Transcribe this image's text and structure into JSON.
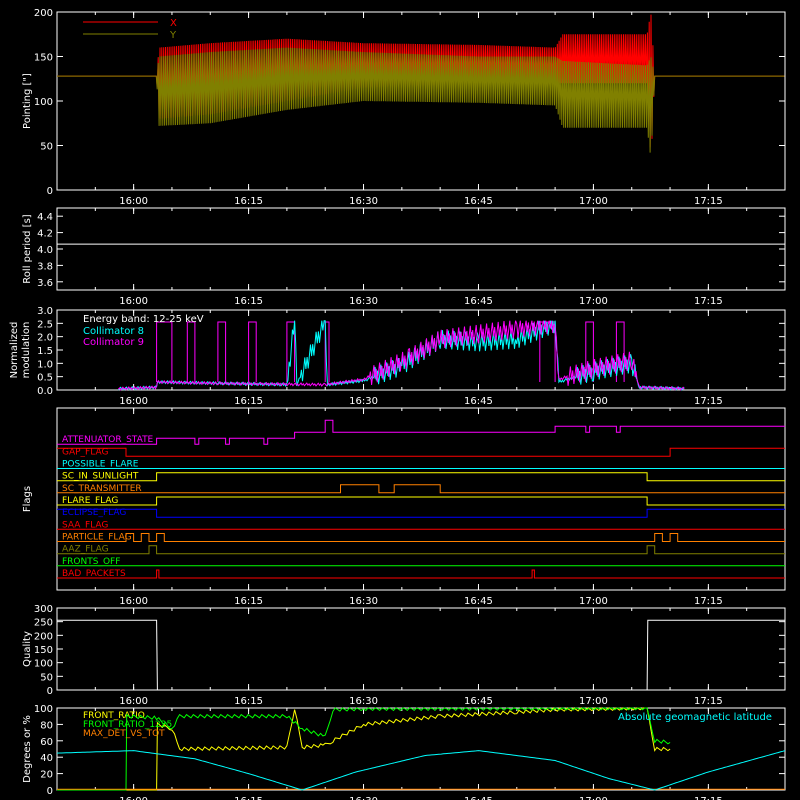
{
  "chart_data": [
    {
      "type": "line",
      "ylabel": "Pointing [\"]",
      "ylim": [
        0,
        200
      ],
      "yticks": [
        0,
        50,
        100,
        150,
        200
      ],
      "xlim": [
        "15:50",
        "17:25"
      ],
      "xticks": [
        "16:00",
        "16:15",
        "16:30",
        "16:45",
        "17:00",
        "17:15"
      ],
      "legend": {
        "position": "top-left",
        "entries": [
          "X",
          "Y"
        ]
      },
      "series": [
        {
          "name": "X",
          "color": "#ff0000",
          "envelope": [
            [
              "15:50",
              128,
              128
            ],
            [
              "16:03",
              128,
              128
            ],
            [
              "16:03.3",
              80,
              160
            ],
            [
              "16:10",
              85,
              165
            ],
            [
              "16:20",
              100,
              170
            ],
            [
              "16:30",
              115,
              165
            ],
            [
              "16:45",
              120,
              163
            ],
            [
              "16:55",
              120,
              160
            ],
            [
              "16:56",
              120,
              175
            ],
            [
              "17:07",
              120,
              175
            ],
            [
              "17:07.5",
              30,
              200
            ],
            [
              "17:08",
              128,
              128
            ],
            [
              "17:25",
              128,
              128
            ]
          ]
        },
        {
          "name": "Y",
          "color": "#808000",
          "envelope": [
            [
              "15:50",
              128,
              128
            ],
            [
              "16:03",
              128,
              128
            ],
            [
              "16:03.3",
              72,
              150
            ],
            [
              "16:10",
              75,
              155
            ],
            [
              "16:20",
              90,
              160
            ],
            [
              "16:30",
              100,
              155
            ],
            [
              "16:45",
              98,
              150
            ],
            [
              "16:55",
              95,
              150
            ],
            [
              "16:56",
              70,
              145
            ],
            [
              "17:07",
              70,
              140
            ],
            [
              "17:07.5",
              35,
              150
            ],
            [
              "17:08",
              128,
              128
            ],
            [
              "17:25",
              128,
              128
            ]
          ]
        }
      ]
    },
    {
      "type": "line",
      "ylabel": "Roll period [s]",
      "ylim": [
        3.5,
        4.5
      ],
      "yticks": [
        "3.6",
        "3.8",
        "4.0",
        "4.2",
        "4.4"
      ],
      "xticks": [
        "16:00",
        "16:15",
        "16:30",
        "16:45",
        "17:00",
        "17:15"
      ],
      "series": [
        {
          "color": "#ffffff",
          "points": [
            [
              "15:50",
              4.06
            ],
            [
              "17:25",
              4.06
            ]
          ]
        }
      ]
    },
    {
      "type": "line",
      "ylabel": "Normalized modulation",
      "ylim": [
        0,
        3
      ],
      "yticks": [
        "0.0",
        "0.5",
        "1.0",
        "1.5",
        "2.0",
        "2.5",
        "3.0"
      ],
      "xticks": [
        "16:00",
        "16:15",
        "16:30",
        "16:45",
        "17:00",
        "17:15"
      ],
      "legend_title": "Energy band: 12-25 keV",
      "series": [
        {
          "name": "Collimator 8",
          "color": "#00ffff",
          "points": [
            [
              "15:58",
              0.05
            ],
            [
              "16:03",
              0.1
            ],
            [
              "16:03.1",
              0.3
            ],
            [
              "16:20",
              0.2
            ],
            [
              "16:21",
              2.6
            ],
            [
              "16:21.3",
              0.2
            ],
            [
              "16:25",
              2.6
            ],
            [
              "16:25.3",
              0.2
            ],
            [
              "16:30",
              0.35
            ],
            [
              "16:35",
              0.9
            ],
            [
              "16:40",
              1.9
            ],
            [
              "16:45",
              1.8
            ],
            [
              "16:50",
              1.9
            ],
            [
              "16:55",
              2.5
            ],
            [
              "16:55.5",
              0.3
            ],
            [
              "17:00",
              0.7
            ],
            [
              "17:05",
              1.0
            ],
            [
              "17:06",
              0.1
            ],
            [
              "17:12",
              0.05
            ]
          ]
        },
        {
          "name": "Collimator 9",
          "color": "#ff00ff",
          "points": [
            [
              "15:58",
              0.05
            ],
            [
              "16:03",
              0.1
            ],
            [
              "16:03.1",
              0.3
            ],
            [
              "16:11",
              0.25
            ],
            [
              "16:25",
              0.2
            ],
            [
              "16:30",
              0.4
            ],
            [
              "16:36",
              1.2
            ],
            [
              "16:40",
              1.9
            ],
            [
              "16:45",
              2.1
            ],
            [
              "16:50",
              2.3
            ],
            [
              "16:55",
              2.5
            ],
            [
              "16:55.5",
              0.4
            ],
            [
              "17:00",
              0.8
            ],
            [
              "17:05",
              1.1
            ],
            [
              "17:06",
              0.1
            ],
            [
              "17:12",
              0.05
            ]
          ]
        }
      ],
      "pulses": [
        [
          "16:03",
          "16:05"
        ],
        [
          "16:07",
          "16:08"
        ],
        [
          "16:11",
          "16:12"
        ],
        [
          "16:15",
          "16:16"
        ],
        [
          "16:20",
          "16:21"
        ],
        [
          "16:25",
          "16:25.5"
        ],
        [
          "16:53",
          "16:55"
        ],
        [
          "16:59",
          "17:00"
        ],
        [
          "17:03",
          "17:04"
        ]
      ]
    },
    {
      "type": "line",
      "ylabel": "Flags",
      "xticks": [
        "16:00",
        "16:15",
        "16:30",
        "16:45",
        "17:00",
        "17:15"
      ],
      "flags": [
        {
          "name": "ATTENUATOR_STATE",
          "color": "#ff00ff",
          "steps": [
            [
              "15:50",
              0
            ],
            [
              "16:03",
              1
            ],
            [
              "16:08",
              0
            ],
            [
              "16:08.5",
              1
            ],
            [
              "16:12",
              0
            ],
            [
              "16:12.5",
              1
            ],
            [
              "16:17",
              0
            ],
            [
              "16:17.5",
              1
            ],
            [
              "16:21",
              2
            ],
            [
              "16:25",
              4
            ],
            [
              "16:26",
              2
            ],
            [
              "16:55",
              3
            ],
            [
              "16:59",
              2
            ],
            [
              "16:59.5",
              3
            ],
            [
              "17:03",
              2
            ],
            [
              "17:03.5",
              3
            ],
            [
              "17:25",
              3
            ]
          ]
        },
        {
          "name": "GAP_FLAG",
          "color": "#ff0000",
          "steps": [
            [
              "15:50",
              1
            ],
            [
              "15:59",
              0
            ],
            [
              "17:10",
              1
            ],
            [
              "17:25",
              1
            ]
          ]
        },
        {
          "name": "POSSIBLE_FLARE",
          "color": "#00ffff",
          "steps": [
            [
              "15:50",
              0
            ],
            [
              "17:25",
              0
            ]
          ]
        },
        {
          "name": "SC_IN_SUNLIGHT",
          "color": "#ffff00",
          "steps": [
            [
              "15:50",
              0
            ],
            [
              "16:03",
              1
            ],
            [
              "17:07",
              0
            ],
            [
              "17:25",
              0
            ]
          ]
        },
        {
          "name": "SC_TRANSMITTER",
          "color": "#ff8000",
          "steps": [
            [
              "15:50",
              0
            ],
            [
              "16:27",
              1
            ],
            [
              "16:32",
              0
            ],
            [
              "16:34",
              1
            ],
            [
              "16:40",
              0
            ],
            [
              "17:25",
              0
            ]
          ]
        },
        {
          "name": "FLARE_FLAG",
          "color": "#ffff00",
          "steps": [
            [
              "15:50",
              0
            ],
            [
              "16:03",
              1
            ],
            [
              "17:07",
              0
            ],
            [
              "17:25",
              0
            ]
          ]
        },
        {
          "name": "ECLIPSE_FLAG",
          "color": "#0000ff",
          "steps": [
            [
              "15:50",
              1
            ],
            [
              "16:03",
              0
            ],
            [
              "17:07",
              1
            ],
            [
              "17:25",
              1
            ]
          ]
        },
        {
          "name": "SAA_FLAG",
          "color": "#ff0000",
          "steps": [
            [
              "15:50",
              0
            ],
            [
              "17:25",
              0
            ]
          ]
        },
        {
          "name": "PARTICLE_FLAG",
          "color": "#ff8000",
          "steps": [
            [
              "15:50",
              0
            ],
            [
              "15:59",
              1
            ],
            [
              "16:00",
              0
            ],
            [
              "16:01",
              1
            ],
            [
              "16:02",
              0
            ],
            [
              "16:03",
              1
            ],
            [
              "16:04",
              0
            ],
            [
              "17:08",
              1
            ],
            [
              "17:09",
              0
            ],
            [
              "17:10",
              1
            ],
            [
              "17:11",
              0
            ],
            [
              "17:25",
              0
            ]
          ]
        },
        {
          "name": "AAZ_FLAG",
          "color": "#808000",
          "steps": [
            [
              "15:50",
              0
            ],
            [
              "16:02",
              1
            ],
            [
              "16:03",
              0
            ],
            [
              "17:07",
              1
            ],
            [
              "17:08",
              0
            ],
            [
              "17:25",
              0
            ]
          ]
        },
        {
          "name": "FRONTS_OFF",
          "color": "#00ff00",
          "steps": [
            [
              "15:50",
              0
            ],
            [
              "17:25",
              0
            ]
          ]
        },
        {
          "name": "BAD_PACKETS",
          "color": "#ff0000",
          "steps": [
            [
              "15:50",
              0
            ],
            [
              "16:03",
              1
            ],
            [
              "16:03.3",
              0
            ],
            [
              "16:52",
              1
            ],
            [
              "16:52.3",
              0
            ],
            [
              "17:25",
              0
            ]
          ]
        }
      ]
    },
    {
      "type": "line",
      "ylabel": "Quality",
      "ylim": [
        0,
        300
      ],
      "yticks": [
        0,
        50,
        100,
        150,
        200,
        250,
        300
      ],
      "xticks": [
        "16:00",
        "16:15",
        "16:30",
        "16:45",
        "17:00",
        "17:15"
      ],
      "series": [
        {
          "color": "#ffffff",
          "points": [
            [
              "15:50",
              255
            ],
            [
              "16:03",
              255
            ],
            [
              "16:03.1",
              0
            ],
            [
              "17:07",
              0
            ],
            [
              "17:07.1",
              255
            ],
            [
              "17:25",
              255
            ]
          ]
        }
      ]
    },
    {
      "type": "line",
      "ylabel": "Degrees or %",
      "ylim": [
        0,
        100
      ],
      "yticks": [
        0,
        20,
        40,
        60,
        80,
        100
      ],
      "xticks": [
        "16:00",
        "16:15",
        "16:30",
        "16:45",
        "17:00",
        "17:15"
      ],
      "legend": {
        "position": "top-left",
        "entries": [
          "FRONT_RATIO",
          "FRONT_RATIO_1225",
          "MAX_DET_VS_TOT"
        ]
      },
      "annotation": "Absolute geomagnetic latitude",
      "series": [
        {
          "name": "FRONT_RATIO",
          "color": "#ffff00",
          "points": [
            [
              "15:50",
              0
            ],
            [
              "16:03",
              0
            ],
            [
              "16:03.1",
              80
            ],
            [
              "16:05",
              75
            ],
            [
              "16:06",
              50
            ],
            [
              "16:20",
              52
            ],
            [
              "16:21",
              100
            ],
            [
              "16:22",
              52
            ],
            [
              "16:25",
              55
            ],
            [
              "16:26",
              60
            ],
            [
              "16:30",
              80
            ],
            [
              "16:40",
              90
            ],
            [
              "16:50",
              95
            ],
            [
              "16:55",
              98
            ],
            [
              "17:07",
              100
            ],
            [
              "17:08",
              50
            ],
            [
              "17:10",
              50
            ]
          ]
        },
        {
          "name": "FRONT_RATIO_1225",
          "color": "#00ff00",
          "points": [
            [
              "15:50",
              0
            ],
            [
              "15:59",
              0
            ],
            [
              "15:59.1",
              90
            ],
            [
              "16:03",
              88
            ],
            [
              "16:05",
              75
            ],
            [
              "16:06",
              90
            ],
            [
              "16:20",
              90
            ],
            [
              "16:22",
              75
            ],
            [
              "16:25",
              65
            ],
            [
              "16:26",
              98
            ],
            [
              "16:30",
              99
            ],
            [
              "17:07",
              100
            ],
            [
              "17:08",
              60
            ],
            [
              "17:10",
              58
            ]
          ]
        },
        {
          "name": "MAX_DET_VS_TOT",
          "color": "#ff8000",
          "points": [
            [
              "15:50",
              1
            ],
            [
              "17:25",
              1
            ]
          ]
        },
        {
          "name": "Absolute geomagnetic latitude",
          "color": "#00ffff",
          "points": [
            [
              "15:50",
              45
            ],
            [
              "16:00",
              48
            ],
            [
              "16:08",
              38
            ],
            [
              "16:15",
              20
            ],
            [
              "16:22",
              0
            ],
            [
              "16:29",
              22
            ],
            [
              "16:38",
              42
            ],
            [
              "16:45",
              48
            ],
            [
              "16:55",
              36
            ],
            [
              "17:02",
              14
            ],
            [
              "17:08",
              0
            ],
            [
              "17:15",
              22
            ],
            [
              "17:25",
              48
            ]
          ]
        }
      ]
    }
  ]
}
